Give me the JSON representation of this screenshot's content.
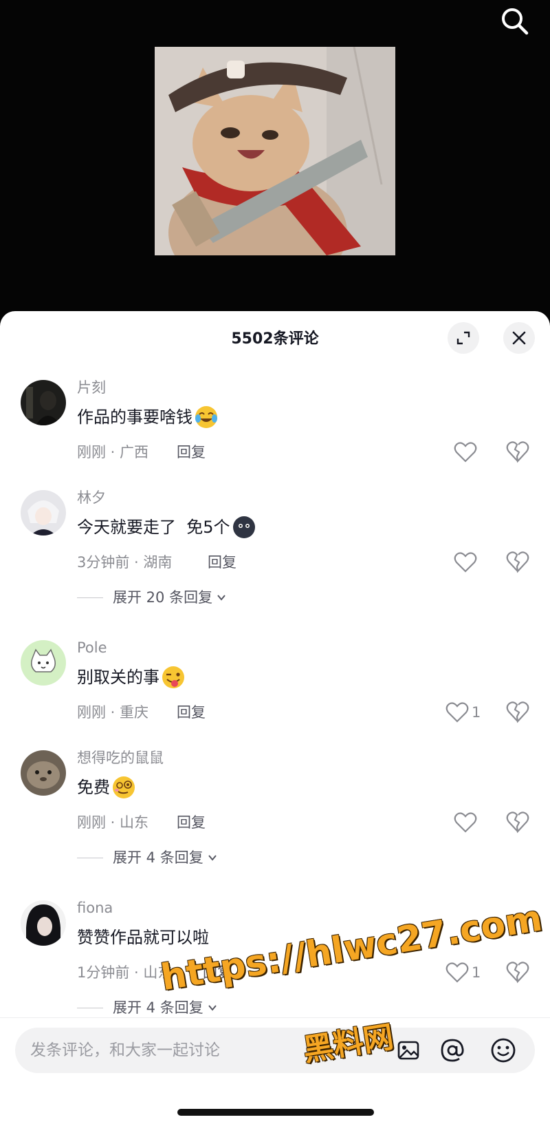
{
  "header": {
    "search_icon": "search-icon"
  },
  "sheet": {
    "title": "5502条评论",
    "expand_icon": "expand-icon",
    "close_icon": "close-icon"
  },
  "comments": [
    {
      "username": "片刻",
      "text": "作品的事要啥钱",
      "emoji": "crying-laughing-emoji",
      "meta": "刚刚 · 广西",
      "reply": "回复",
      "likes": ""
    },
    {
      "username": "林夕",
      "text": "今天就要走了  免5个",
      "emoji": "dark-blob-emoji",
      "meta": "3分钟前 · 湖南",
      "reply": "回复",
      "likes": "",
      "expand": "展开 20 条回复"
    },
    {
      "username": "Pole",
      "text": "别取关的事",
      "emoji": "winking-tongue-emoji",
      "meta": "刚刚 · 重庆",
      "reply": "回复",
      "likes": "1"
    },
    {
      "username": "想得吃的鼠鼠",
      "text": "免费",
      "emoji": "woozy-face-emoji",
      "meta": "刚刚 · 山东",
      "reply": "回复",
      "likes": "",
      "expand": "展开 4 条回复"
    },
    {
      "username": "fiona",
      "text": "赞赞作品就可以啦",
      "meta": "1分钟前 · 山东",
      "reply": "回复",
      "likes": "1",
      "expand": "展开 4 条回复"
    }
  ],
  "input": {
    "placeholder": "发条评论，和大家一起讨论",
    "image_icon": "image-icon",
    "mention_icon": "at-icon",
    "emoji_icon": "smiley-icon"
  },
  "watermark": {
    "line1": "https://hlwc27.com",
    "line2": "黑料网"
  },
  "colors": {
    "text_primary": "#161823",
    "text_secondary": "#8a8b91",
    "watermark": "#f5a623"
  }
}
